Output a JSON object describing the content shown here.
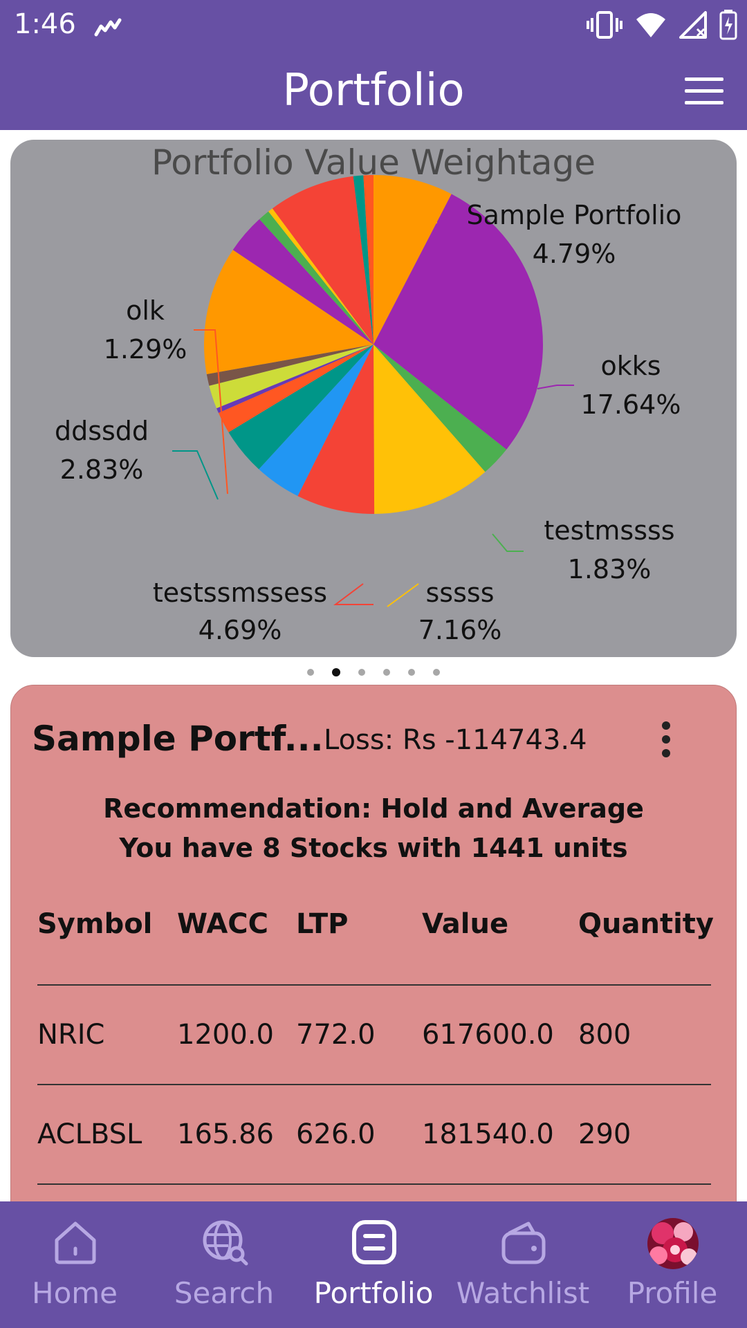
{
  "status_bar": {
    "time": "1:46"
  },
  "app_bar": {
    "title": "Portfolio"
  },
  "chart": {
    "title": "Portfolio Value Weightage"
  },
  "chart_data": {
    "type": "pie",
    "title": "Portfolio Value Weightage",
    "labels": [
      {
        "name": "Sample Portfolio",
        "percent": "4.79%"
      },
      {
        "name": "okks",
        "percent": "17.64%"
      },
      {
        "name": "testmssss",
        "percent": "1.83%"
      },
      {
        "name": "sssss",
        "percent": "7.16%"
      },
      {
        "name": "testssmssess",
        "percent": "4.69%"
      },
      {
        "name": "ddssdd",
        "percent": "2.83%"
      },
      {
        "name": "olk",
        "percent": "1.29%"
      }
    ],
    "slices": [
      {
        "value": 4.79,
        "color": "#ff9800"
      },
      {
        "value": 17.64,
        "color": "#9c27b0"
      },
      {
        "value": 1.83,
        "color": "#4caf50"
      },
      {
        "value": 7.16,
        "color": "#ffc107"
      },
      {
        "value": 4.69,
        "color": "#f44336"
      },
      {
        "value": 2.8,
        "color": "#2196f3"
      },
      {
        "value": 2.83,
        "color": "#009688"
      },
      {
        "value": 1.29,
        "color": "#ff5722"
      },
      {
        "value": 0.3,
        "color": "#673ab7"
      },
      {
        "value": 1.4,
        "color": "#cddc39"
      },
      {
        "value": 0.7,
        "color": "#795548"
      },
      {
        "value": 7.7,
        "color": "#ff9800"
      },
      {
        "value": 2.4,
        "color": "#9c27b0"
      },
      {
        "value": 0.7,
        "color": "#4caf50"
      },
      {
        "value": 0.3,
        "color": "#ffc107"
      },
      {
        "value": 5.2,
        "color": "#f44336"
      },
      {
        "value": 0.6,
        "color": "#009688"
      },
      {
        "value": 0.6,
        "color": "#ff5722"
      }
    ]
  },
  "pager": {
    "count": 6,
    "active_index": 1
  },
  "portfolio": {
    "name": "Sample Portf...",
    "loss": "Loss: Rs -114743.4",
    "recommendation": "Recommendation:  Hold and Average",
    "summary": "You have 8 Stocks with 1441 units",
    "columns": [
      "Symbol",
      "WACC",
      "LTP",
      "Value",
      "Quantity"
    ],
    "rows": [
      [
        "NRIC",
        "1200.0",
        "772.0",
        "617600.0",
        "800"
      ],
      [
        "ACLBSL",
        "165.86",
        "626.0",
        "181540.0",
        "290"
      ]
    ]
  },
  "bottom_nav": {
    "items": [
      {
        "label": "Home",
        "icon": "home-icon"
      },
      {
        "label": "Search",
        "icon": "globe-search-icon"
      },
      {
        "label": "Portfolio",
        "icon": "portfolio-icon"
      },
      {
        "label": "Watchlist",
        "icon": "wallet-icon"
      },
      {
        "label": "Profile",
        "icon": "avatar"
      }
    ],
    "active_index": 2
  },
  "colors": {
    "primary": "#6750a4",
    "chart_card": "#9b9ba0",
    "portfolio_card": "#dc8e8e",
    "nav_inactive": "#b7a8e3"
  }
}
